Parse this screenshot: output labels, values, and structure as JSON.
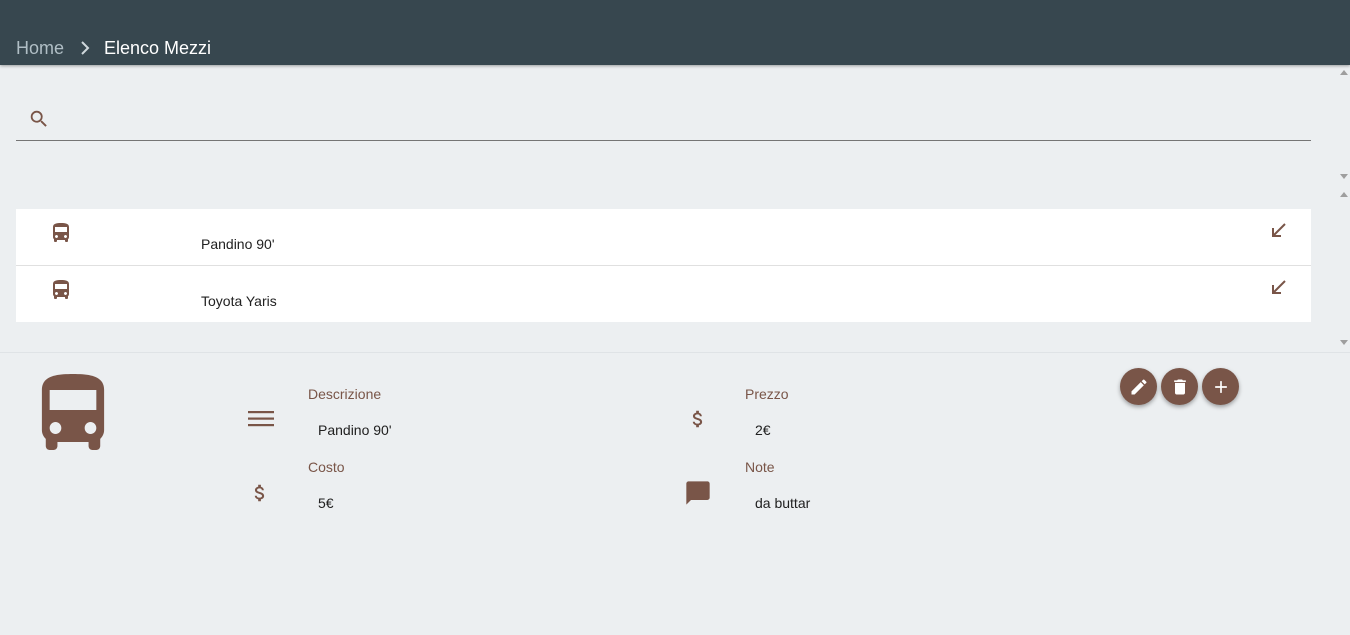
{
  "header": {
    "breadcrumb": {
      "home_label": "Home",
      "separator_icon": "chevron-right-icon",
      "current_label": "Elenco Mezzi"
    }
  },
  "search": {
    "icon": "search-icon",
    "value": "",
    "placeholder": ""
  },
  "vehicles": {
    "items": [
      {
        "icon": "bus-icon",
        "label": "Pandino 90'",
        "action_icon": "arrow-south-west-icon"
      },
      {
        "icon": "bus-icon",
        "label": "Toyota Yaris",
        "action_icon": "arrow-south-west-icon"
      }
    ]
  },
  "detail": {
    "icon": "bus-icon",
    "fields": {
      "descrizione": {
        "label": "Descrizione",
        "value": "Pandino 90'",
        "icon": "subject-lines-icon"
      },
      "prezzo": {
        "label": "Prezzo",
        "value": "2€",
        "icon": "dollar-icon"
      },
      "costo": {
        "label": "Costo",
        "value": "5€",
        "icon": "dollar-icon"
      },
      "note": {
        "label": "Note",
        "value": "da buttar",
        "icon": "comment-icon"
      }
    },
    "actions": [
      {
        "name": "edit",
        "icon": "pencil-icon"
      },
      {
        "name": "delete",
        "icon": "trash-icon"
      },
      {
        "name": "add",
        "icon": "plus-icon"
      }
    ]
  },
  "colors": {
    "header_bg": "#37474f",
    "page_bg": "#eceff1",
    "accent_brown": "#795548",
    "list_bg": "#ffffff"
  }
}
